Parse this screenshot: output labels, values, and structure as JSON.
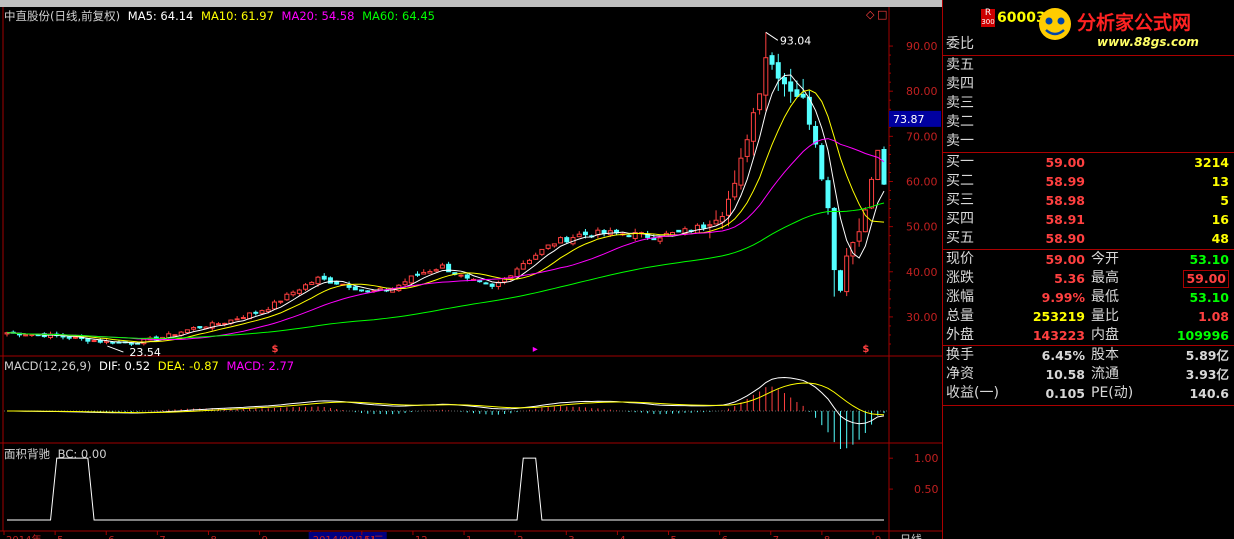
{
  "colors": {
    "up": "#ff4040",
    "down": "#54ffff",
    "ma5": "#ffffff",
    "ma10": "#ffff00",
    "ma20": "#ff00ff",
    "ma60": "#00ff00",
    "grid": "#a00000",
    "axis_text": "#c02020"
  },
  "main_legend": {
    "title": "中直股份(日线,前复权)",
    "ma5": "MA5: 64.14",
    "ma10": "MA10: 61.97",
    "ma20": "MA20: 54.58",
    "ma60": "MA60: 64.45"
  },
  "macd_legend": {
    "title": "MACD(12,26,9)",
    "dif": "DIF: 0.52",
    "dea": "DEA: -0.87",
    "macd": "MACD: 2.77"
  },
  "bc_legend": {
    "title": "面积背驰",
    "bc": "BC: 0.00"
  },
  "price_annotations": {
    "high": "93.04",
    "low": "23.54",
    "current_marker": "73.87"
  },
  "bottom_axis": {
    "labels": [
      "2014年",
      "5",
      "6",
      "7",
      "8",
      "9",
      "2014/09/16/二",
      "11",
      "12",
      "1",
      "2",
      "3",
      "4",
      "5",
      "6",
      "7",
      "8",
      "9"
    ],
    "period_label": "日线"
  },
  "chart_data": [
    {
      "type": "candlestick",
      "title": "中直股份(日线,前复权)",
      "yticks": [
        "90.00",
        "80.00",
        "70.00",
        "60.00",
        "50.00",
        "40.00",
        "30.00"
      ],
      "ylim": [
        24,
        94
      ],
      "close_trend": [
        [
          0,
          26.5
        ],
        [
          8,
          25.8
        ],
        [
          15,
          24.6
        ],
        [
          20,
          24.2
        ],
        [
          25,
          25.5
        ],
        [
          30,
          27.5
        ],
        [
          35,
          28.8
        ],
        [
          42,
          32
        ],
        [
          46,
          35.5
        ],
        [
          50,
          38.5
        ],
        [
          55,
          37
        ],
        [
          58,
          35.5
        ],
        [
          62,
          36.2
        ],
        [
          66,
          39.5
        ],
        [
          70,
          41.2
        ],
        [
          74,
          38.2
        ],
        [
          78,
          36.5
        ],
        [
          80,
          38.5
        ],
        [
          83,
          42
        ],
        [
          88,
          46.5
        ],
        [
          92,
          48.2
        ],
        [
          96,
          48.6
        ],
        [
          100,
          48.4
        ],
        [
          104,
          47.8
        ],
        [
          108,
          48.6
        ],
        [
          112,
          50.2
        ],
        [
          115,
          53
        ],
        [
          117,
          59
        ],
        [
          119,
          70
        ],
        [
          121,
          80.5
        ],
        [
          122,
          88
        ],
        [
          123,
          86
        ],
        [
          125,
          82
        ],
        [
          128,
          78
        ],
        [
          130,
          69
        ],
        [
          132,
          54
        ],
        [
          133,
          41
        ],
        [
          134,
          36
        ],
        [
          135,
          44
        ],
        [
          137,
          49
        ],
        [
          139,
          60
        ],
        [
          140,
          67
        ],
        [
          141,
          59
        ]
      ]
    },
    {
      "type": "bar",
      "title": "MACD(12,26,9)",
      "series": [
        {
          "name": "DIF",
          "value": 0.52
        },
        {
          "name": "DEA",
          "value": -0.87
        },
        {
          "name": "MACD",
          "value": 2.77
        }
      ]
    },
    {
      "type": "line",
      "title": "面积背驰",
      "yticks": [
        "1.00",
        "0.50"
      ],
      "ylim": [
        0,
        1.1
      ],
      "series": [
        {
          "name": "BC",
          "points": [
            [
              0,
              0
            ],
            [
              7,
              0
            ],
            [
              8,
              1
            ],
            [
              13,
              1
            ],
            [
              14,
              0
            ],
            [
              82,
              0
            ],
            [
              83,
              1
            ],
            [
              85,
              1
            ],
            [
              86,
              0
            ],
            [
              141,
              0
            ]
          ]
        }
      ]
    }
  ],
  "quote": {
    "code": "60003",
    "r_badge": "R",
    "r_badge_sub": "300",
    "weibi_label": "委比",
    "sell": [
      {
        "label": "卖五",
        "price": "",
        "vol": ""
      },
      {
        "label": "卖四",
        "price": "",
        "vol": ""
      },
      {
        "label": "卖三",
        "price": "",
        "vol": ""
      },
      {
        "label": "卖二",
        "price": "",
        "vol": ""
      },
      {
        "label": "卖一",
        "price": "",
        "vol": ""
      }
    ],
    "buy": [
      {
        "label": "买一",
        "price": "59.00",
        "vol": "3214"
      },
      {
        "label": "买二",
        "price": "58.99",
        "vol": "13"
      },
      {
        "label": "买三",
        "price": "58.98",
        "vol": "5"
      },
      {
        "label": "买四",
        "price": "58.91",
        "vol": "16"
      },
      {
        "label": "买五",
        "price": "58.90",
        "vol": "48"
      }
    ],
    "stats": [
      {
        "l1": "现价",
        "v1": "59.00",
        "c1": "#ff4040",
        "l2": "今开",
        "v2": "53.10",
        "c2": "#00ff00",
        "box2": false
      },
      {
        "l1": "涨跌",
        "v1": "5.36",
        "c1": "#ff4040",
        "l2": "最高",
        "v2": "59.00",
        "c2": "#ff4040",
        "box2": true
      },
      {
        "l1": "涨幅",
        "v1": "9.99%",
        "c1": "#ff4040",
        "l2": "最低",
        "v2": "53.10",
        "c2": "#00ff00",
        "box2": false
      },
      {
        "l1": "总量",
        "v1": "253219",
        "c1": "#ffff00",
        "l2": "量比",
        "v2": "1.08",
        "c2": "#ff4040",
        "box2": false
      },
      {
        "l1": "外盘",
        "v1": "143223",
        "c1": "#ff4040",
        "l2": "内盘",
        "v2": "109996",
        "c2": "#00ff00",
        "box2": false
      }
    ],
    "stats2": [
      {
        "l1": "换手",
        "v1": "6.45%",
        "l2": "股本",
        "v2": "5.89亿"
      },
      {
        "l1": "净资",
        "v1": "10.58",
        "l2": "流通",
        "v2": "3.93亿"
      },
      {
        "l1": "收益(一)",
        "v1": "0.105",
        "l2": "PE(动)",
        "v2": "140.6"
      }
    ]
  },
  "watermark": {
    "text": "分析家公式网",
    "url": "www.88gs.com"
  }
}
